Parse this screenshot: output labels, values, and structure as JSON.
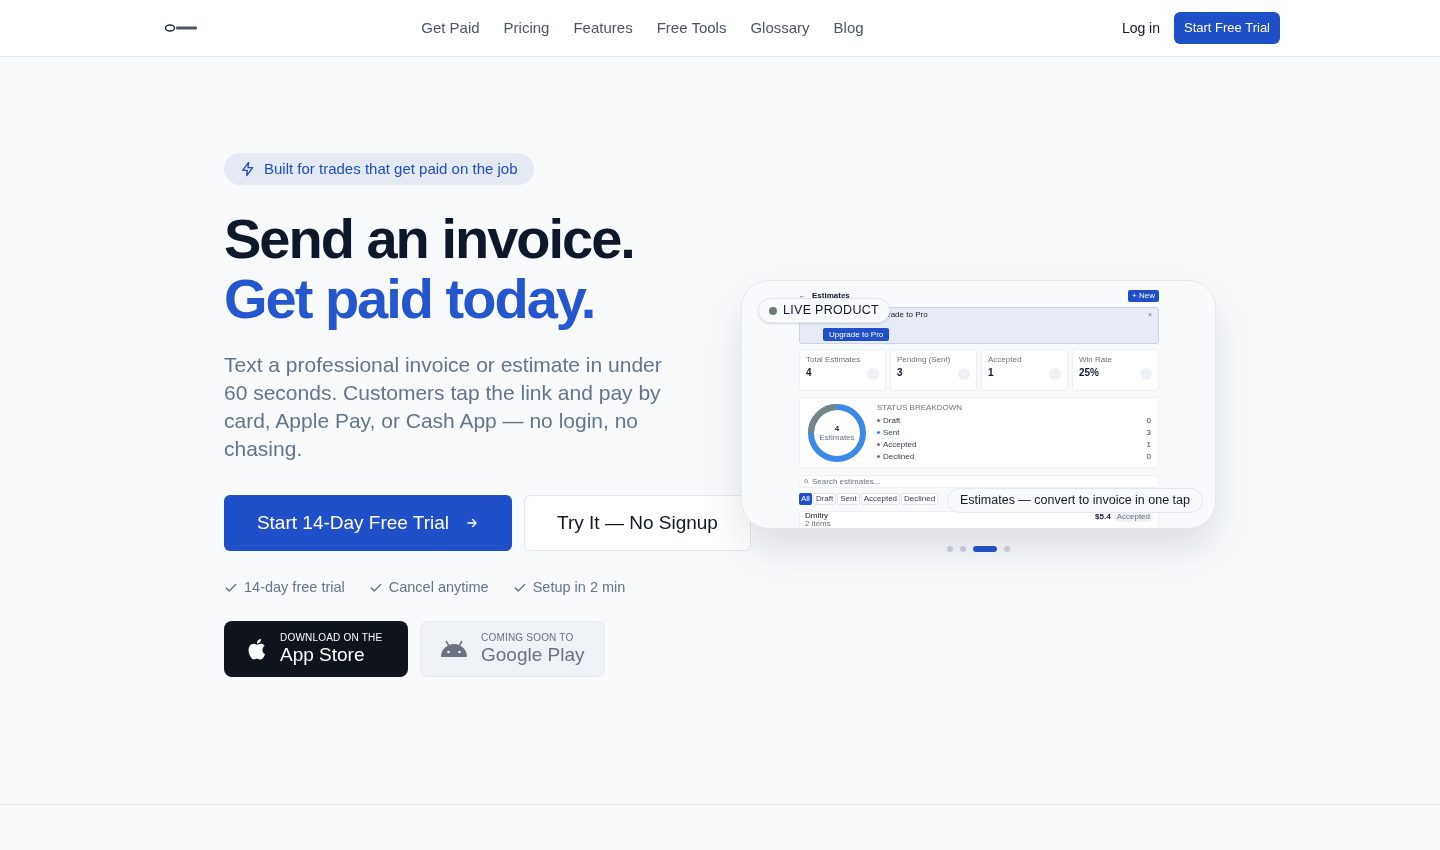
{
  "nav": {
    "links": [
      "Get Paid",
      "Pricing",
      "Features",
      "Free Tools",
      "Glossary",
      "Blog"
    ],
    "login": "Log in",
    "cta": "Start Free Trial"
  },
  "hero": {
    "badge": "Built for trades that get paid on the job",
    "headline_line1": "Send an invoice.",
    "headline_line2": "Get paid today.",
    "description": "Text a professional invoice or estimate in under 60 seconds. Customers tap the link and pay by card, Apple Pay, or Cash App — no login, no chasing.",
    "primary_button": "Start 14-Day Free Trial",
    "secondary_button": "Try It — No Signup",
    "perks": [
      "14-day free trial",
      "Cancel anytime",
      "Setup in 2 min"
    ],
    "store_buttons": [
      {
        "kind": "apple",
        "caption": "DOWNLOAD ON THE",
        "store": "App Store",
        "disabled": false
      },
      {
        "kind": "android",
        "caption": "COMING SOON TO",
        "store": "Google Play",
        "disabled": true
      }
    ]
  },
  "product_preview": {
    "live_badge": "LIVE PRODUCT",
    "caption": "Estimates — convert to invoice in one tap",
    "screen": {
      "back": "←",
      "title": "Estimates",
      "new_button": "+ New",
      "banner_title": "rade to Pro",
      "banner_close": "×",
      "upgrade_button": "Upgrade to Pro",
      "stats": [
        {
          "label": "Total Estimates",
          "value": "4"
        },
        {
          "label": "Pending (Sent)",
          "value": "3"
        },
        {
          "label": "Accepted",
          "value": "1"
        },
        {
          "label": "Win Rate",
          "value": "25%"
        }
      ],
      "breakdown": {
        "title": "STATUS BREAKDOWN",
        "center_value": "4",
        "center_label": "Estimates",
        "items": [
          {
            "label": "Draft",
            "count": "0",
            "color": "#6b7280"
          },
          {
            "label": "Sent",
            "count": "3",
            "color": "#3b82f6"
          },
          {
            "label": "Accepted",
            "count": "1",
            "color": "#6b7280"
          },
          {
            "label": "Declined",
            "count": "0",
            "color": "#6b7280"
          }
        ]
      },
      "search_placeholder": "Search estimates...",
      "filters": [
        {
          "label": "All",
          "selected": true
        },
        {
          "label": "Draft",
          "selected": false
        },
        {
          "label": "Sent",
          "selected": false
        },
        {
          "label": "Accepted",
          "selected": false
        },
        {
          "label": "Declined",
          "selected": false
        }
      ],
      "rows": [
        {
          "name": "Dmitry",
          "sub": "2 items",
          "amount": "$5.4",
          "status": "Accepted"
        }
      ]
    },
    "carousel_dots": [
      {
        "selected": false
      },
      {
        "selected": false
      },
      {
        "selected": true
      },
      {
        "selected": false
      }
    ]
  }
}
